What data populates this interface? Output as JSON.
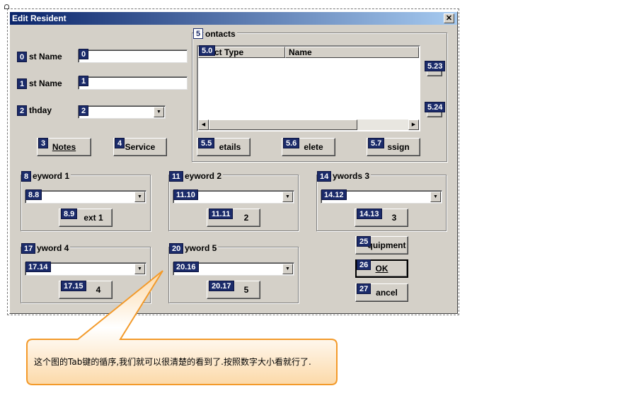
{
  "window": {
    "title": "Edit Resident",
    "close_glyph": "✕"
  },
  "fields": {
    "first_name": {
      "label": "st Name",
      "badge": "0",
      "input_badge": "0",
      "value": ""
    },
    "last_name": {
      "label": "st Name",
      "badge": "1",
      "input_badge": "1",
      "value": ""
    },
    "birthday": {
      "label": "thday",
      "badge": "2",
      "input_badge": "2",
      "value": ""
    }
  },
  "buttons": {
    "notes": {
      "badge": "3",
      "label": "Notes"
    },
    "service": {
      "badge": "4",
      "label": "Service"
    },
    "details": {
      "badge": "5.5",
      "label": "etails"
    },
    "delete": {
      "badge": "5.6",
      "label": "elete"
    },
    "assign": {
      "badge": "5.7",
      "label": "ssign"
    },
    "equipment": {
      "badge": "25",
      "label": "quipment"
    },
    "ok": {
      "badge": "26",
      "label": "OK"
    },
    "cancel": {
      "badge": "27",
      "label": "ancel"
    }
  },
  "contacts": {
    "group_badge": "5",
    "group_label": "ontacts",
    "list_badge": "5.0",
    "col_type": "ntact Type",
    "col_name": "Name",
    "side_badge_1": "5.23",
    "side_badge_2": "5.24"
  },
  "keywords": [
    {
      "group_badge": "8",
      "label": "eyword 1",
      "combo_badge": "8.8",
      "btn_badge": "8.9",
      "btn_label": "ext 1"
    },
    {
      "group_badge": "11",
      "label": "eyword 2",
      "combo_badge": "11.10",
      "btn_badge": "11.11",
      "btn_label": "2"
    },
    {
      "group_badge": "14",
      "label": "ywords 3",
      "combo_badge": "14.12",
      "btn_badge": "14.13",
      "btn_label": "3"
    },
    {
      "group_badge": "17",
      "label": "yword 4",
      "combo_badge": "17.14",
      "btn_badge": "17.15",
      "btn_label": "4"
    },
    {
      "group_badge": "20",
      "label": "yword 5",
      "combo_badge": "20.16",
      "btn_badge": "20.17",
      "btn_label": "5"
    }
  ],
  "callout": {
    "text": "这个图的Tab键的循序,我们就可以很清楚的看到了.按照数字大小看就行了."
  },
  "colors": {
    "badge_bg": "#1b2b6a",
    "dialog_bg": "#d4d0c8",
    "callout": "#f39a2a"
  }
}
